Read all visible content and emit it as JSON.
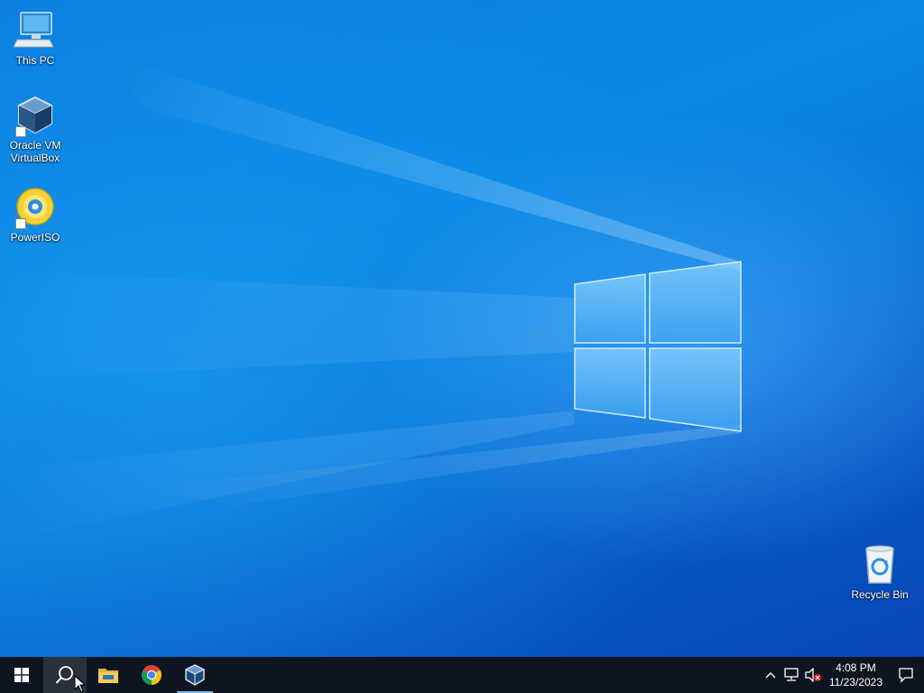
{
  "desktop": {
    "icons": [
      {
        "label_line1": "This PC",
        "label_line2": "",
        "icon": "this-pc-icon"
      },
      {
        "label_line1": "Oracle VM",
        "label_line2": "VirtualBox",
        "icon": "virtualbox-icon"
      },
      {
        "label_line1": "PowerISO",
        "label_line2": "",
        "icon": "poweriso-icon"
      },
      {
        "label_line1": "Recycle Bin",
        "label_line2": "",
        "icon": "recycle-bin-icon"
      }
    ]
  },
  "taskbar": {
    "buttons": [
      {
        "icon": "windows-start-icon"
      },
      {
        "icon": "search-icon"
      },
      {
        "icon": "file-explorer-icon"
      },
      {
        "icon": "chrome-icon"
      },
      {
        "icon": "virtualbox-icon"
      }
    ],
    "tray": {
      "icons": [
        "chevron-up-icon",
        "network-icon",
        "speaker-muted-icon"
      ],
      "time": "4:08 PM",
      "date": "11/23/2023",
      "notifications_icon": "action-center-icon"
    }
  },
  "colors": {
    "taskbar_bg": "#0e1520",
    "accent": "#76b9ed",
    "desktop_blue": "#0a78db"
  }
}
